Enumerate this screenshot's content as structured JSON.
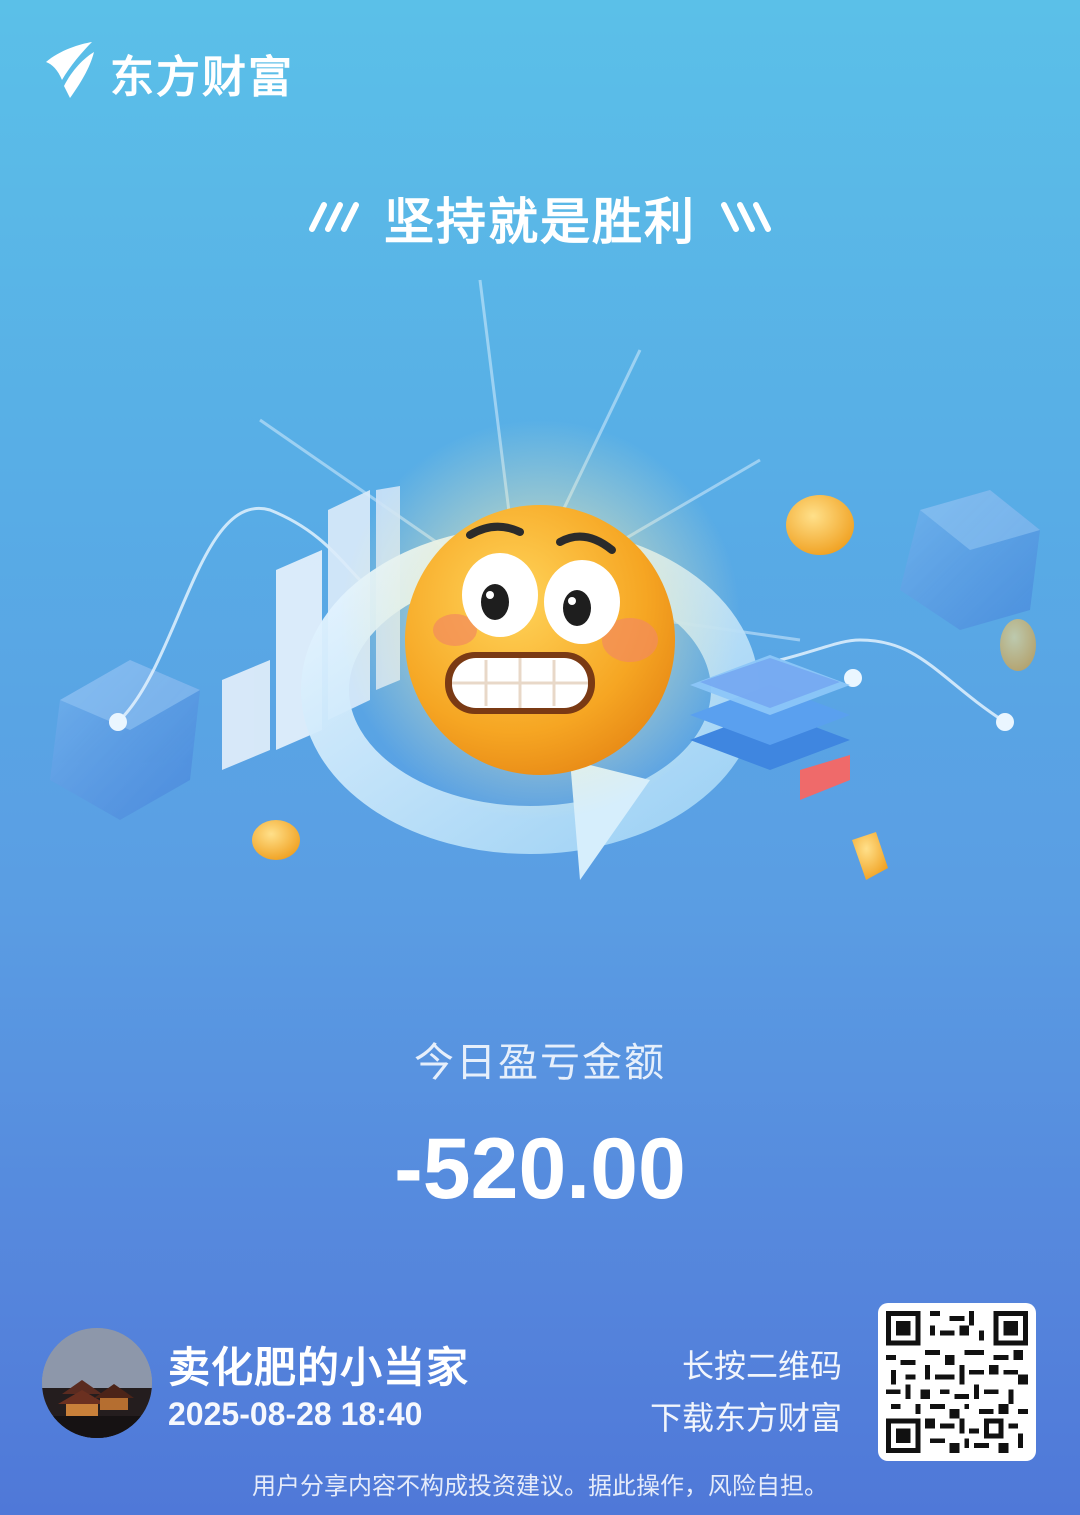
{
  "brand": {
    "name": "东方财富",
    "logo_icon": "eastmoney-logo-icon"
  },
  "slogan": "坚持就是胜利",
  "hero": {
    "illustration": "grimacing-emoji-with-charts"
  },
  "pnl": {
    "label": "今日盈亏金额",
    "value": "-520.00"
  },
  "user": {
    "name": "卖化肥的小当家",
    "time": "2025-08-28 18:40",
    "avatar_icon": "temple-at-night-avatar"
  },
  "download": {
    "line1": "长按二维码",
    "line2": "下载东方财富",
    "qr_icon": "qr-code-icon"
  },
  "disclaimer": "用户分享内容不构成投资建议。据此操作，风险自担。",
  "colors": {
    "bg_top": "#5bc0e8",
    "bg_bottom": "#4f78d8",
    "emoji": "#f6b233"
  }
}
